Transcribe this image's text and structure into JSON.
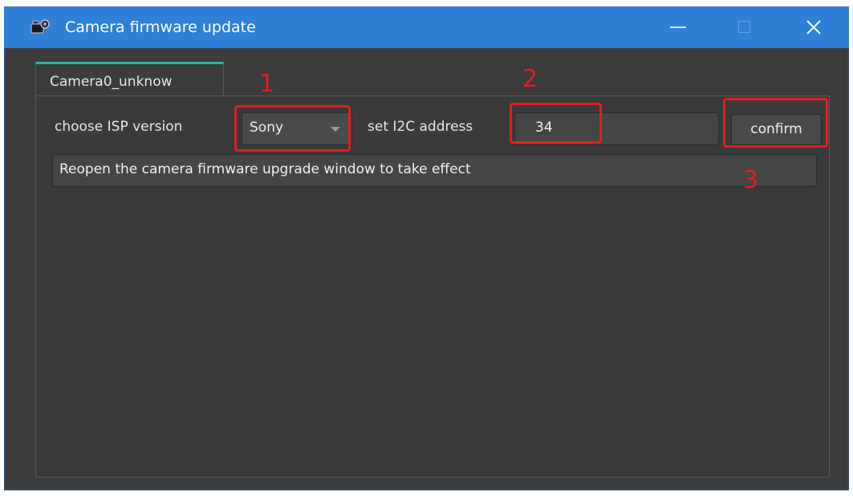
{
  "window": {
    "title": "Camera firmware update",
    "icon": "camera-icon",
    "controls": {
      "minimize_icon": "minimize-icon",
      "maximize_icon": "maximize-icon",
      "close_icon": "close-icon"
    }
  },
  "tabs": [
    {
      "label": "Camera0_unknow",
      "active": true
    }
  ],
  "form": {
    "isp_label": "choose ISP version",
    "isp_value": "Sony",
    "i2c_label": "set I2C address",
    "i2c_value": "34",
    "confirm_label": "confirm"
  },
  "status": {
    "message": "Reopen the camera firmware upgrade window to take effect"
  },
  "annotations": [
    "1",
    "2",
    "3"
  ],
  "colors": {
    "titlebar": "#2f7fd8",
    "background": "#3c3c3c",
    "tab_accent": "#29b3a3",
    "annotation": "#e02020"
  }
}
